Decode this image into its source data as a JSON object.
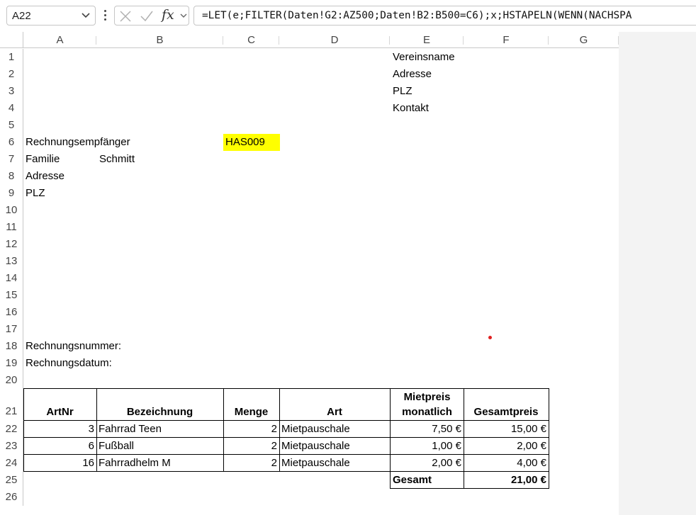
{
  "formula_bar": {
    "name_box": "A22",
    "fx_label": "fx",
    "formula": "=LET(e;FILTER(Daten!G2:AZ500;Daten!B2:B500=C6);x;HSTAPELN(WENN(NACHSPA"
  },
  "columns": [
    "A",
    "B",
    "C",
    "D",
    "E",
    "F",
    "G"
  ],
  "rows": [
    "1",
    "2",
    "3",
    "4",
    "5",
    "6",
    "7",
    "8",
    "9",
    "10",
    "11",
    "12",
    "13",
    "14",
    "15",
    "16",
    "17",
    "18",
    "19",
    "20",
    "21",
    "22",
    "23",
    "24",
    "25",
    "26"
  ],
  "sender": {
    "line1": "Vereinsname",
    "line2": "Adresse",
    "line3": "PLZ",
    "line4": "Kontakt"
  },
  "recipient": {
    "label": "Rechnungsempfänger",
    "id": "HAS009",
    "family_label": "Familie",
    "family_name": "Schmitt",
    "address_label": "Adresse",
    "plz_label": "PLZ"
  },
  "invoice_meta": {
    "number_label": "Rechnungsnummer:",
    "date_label": "Rechnungsdatum:"
  },
  "table": {
    "headers": {
      "artnr": "ArtNr",
      "bezeichnung": "Bezeichnung",
      "menge": "Menge",
      "art": "Art",
      "mietpreis_1": "Mietpreis",
      "mietpreis_2": "monatlich",
      "gesamtpreis": "Gesamtpreis"
    },
    "rows": [
      {
        "artnr": "3",
        "bezeichnung": "Fahrrad Teen",
        "menge": "2",
        "art": "Mietpauschale",
        "mietpreis": "7,50 €",
        "gesamtpreis": "15,00 €"
      },
      {
        "artnr": "6",
        "bezeichnung": "Fußball",
        "menge": "2",
        "art": "Mietpauschale",
        "mietpreis": "1,00 €",
        "gesamtpreis": "2,00 €"
      },
      {
        "artnr": "16",
        "bezeichnung": "Fahrradhelm M",
        "menge": "2",
        "art": "Mietpauschale",
        "mietpreis": "2,00 €",
        "gesamtpreis": "4,00 €"
      }
    ],
    "total_label": "Gesamt",
    "total_value": "21,00 €"
  },
  "colors": {
    "highlight": "#ffff00",
    "marker_dot": "#e02020"
  }
}
